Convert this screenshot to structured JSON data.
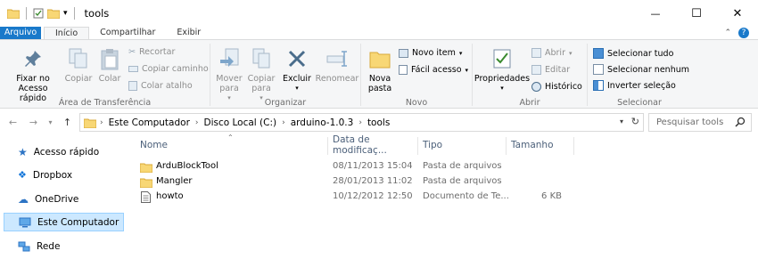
{
  "window": {
    "title": "tools",
    "minimize_glyph": "—",
    "maximize_glyph": "☐",
    "close_glyph": "✕"
  },
  "ribbon_tabs": {
    "file": "Arquivo",
    "home": "Início",
    "share": "Compartilhar",
    "view": "Exibir"
  },
  "clipboard": {
    "pin": "Fixar no Acesso rápido",
    "copy": "Copiar",
    "paste": "Colar",
    "cut": "Recortar",
    "copy_path": "Copiar caminho",
    "paste_shortcut": "Colar atalho",
    "label": "Área de Transferência"
  },
  "organize": {
    "move": "Mover para",
    "copy": "Copiar para",
    "delete": "Excluir",
    "rename": "Renomear",
    "label": "Organizar"
  },
  "new": {
    "folder": "Nova pasta",
    "item": "Novo item",
    "easy": "Fácil acesso",
    "label": "Novo"
  },
  "open": {
    "properties": "Propriedades",
    "open": "Abrir",
    "edit": "Editar",
    "history": "Histórico",
    "label": "Abrir"
  },
  "select": {
    "all": "Selecionar tudo",
    "none": "Selecionar nenhum",
    "invert": "Inverter seleção",
    "label": "Selecionar"
  },
  "address": {
    "crumbs": [
      "Este Computador",
      "Disco Local (C:)",
      "arduino-1.0.3",
      "tools"
    ],
    "search_placeholder": "Pesquisar tools"
  },
  "nav_pane": {
    "quick": "Acesso rápido",
    "dropbox": "Dropbox",
    "onedrive": "OneDrive",
    "computer": "Este Computador",
    "network": "Rede"
  },
  "columns": {
    "name": "Nome",
    "date": "Data de modificaç...",
    "type": "Tipo",
    "size": "Tamanho"
  },
  "files": [
    {
      "name": "ArduBlockTool",
      "date": "08/11/2013 15:04",
      "type": "Pasta de arquivos",
      "size": "",
      "icon": "folder-icon"
    },
    {
      "name": "Mangler",
      "date": "28/01/2013 11:02",
      "type": "Pasta de arquivos",
      "size": "",
      "icon": "folder-icon"
    },
    {
      "name": "howto",
      "date": "10/12/2012 12:50",
      "type": "Documento de Te...",
      "size": "6 KB",
      "icon": "text-document-icon"
    }
  ],
  "colors": {
    "file_tab": "#1979ca",
    "folder": "#f8d775",
    "selection": "#cce8ff",
    "header_text": "#4c607a"
  }
}
